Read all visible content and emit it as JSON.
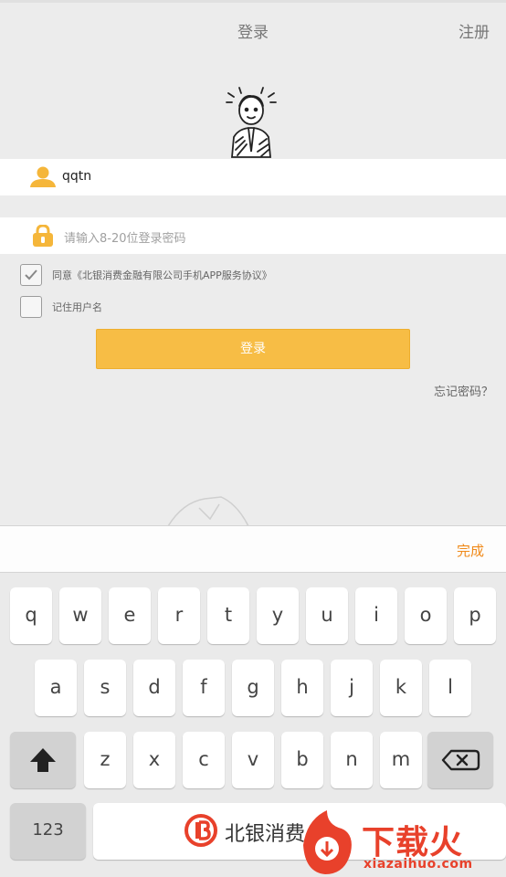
{
  "header": {
    "title": "登录",
    "register": "注册"
  },
  "form": {
    "username_value": "qqtn",
    "password_placeholder": "请输入8-20位登录密码",
    "agree_label": "同意《北银消费金融有限公司手机APP服务协议》",
    "agree_checked": true,
    "remember_label": "记住用户名",
    "remember_checked": false,
    "login_label": "登录",
    "forgot_label": "忘记密码？"
  },
  "keyboard": {
    "done_label": "完成",
    "row1": [
      "q",
      "w",
      "e",
      "r",
      "t",
      "y",
      "u",
      "i",
      "o",
      "p"
    ],
    "row2": [
      "a",
      "s",
      "d",
      "f",
      "g",
      "h",
      "j",
      "k",
      "l"
    ],
    "row3": [
      "z",
      "x",
      "c",
      "v",
      "b",
      "n",
      "m"
    ],
    "numbers_label": "123",
    "space_brand_text": "北银消费"
  },
  "watermark": {
    "text": "下载火",
    "url": "xiazaihuo.com"
  },
  "icons": {
    "user": "user-icon",
    "lock": "lock-icon",
    "shift": "shift-icon",
    "backspace": "backspace-icon",
    "brand": "brand-logo-icon"
  },
  "colors": {
    "accent": "#f7bd45",
    "icon": "#f5b63a",
    "done": "#f08a1a",
    "watermark": "#e8412b"
  }
}
